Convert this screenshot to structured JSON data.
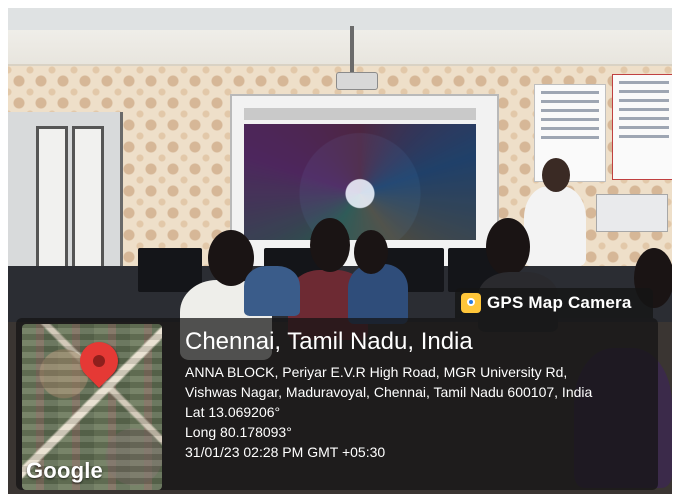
{
  "overlay": {
    "app_name": "GPS Map Camera",
    "location": "Chennai, Tamil Nadu, India",
    "address_line1": "ANNA BLOCK, Periyar E.V.R High Road, MGR University Rd,",
    "address_line2": "Vishwas Nagar, Maduravoyal, Chennai, Tamil Nadu 600107, India",
    "latitude": "Lat 13.069206°",
    "longitude": "Long 80.178093°",
    "datetime": "31/01/23 02:28 PM GMT +05:30",
    "map_brand": "Google"
  },
  "colors": {
    "pin": "#e53935",
    "overlay_bg": "rgba(20,20,20,0.72)",
    "gps_icon": "#ffc63a"
  },
  "icons": {
    "app_icon": "gps-map-camera-icon",
    "marker": "map-pin-icon"
  }
}
